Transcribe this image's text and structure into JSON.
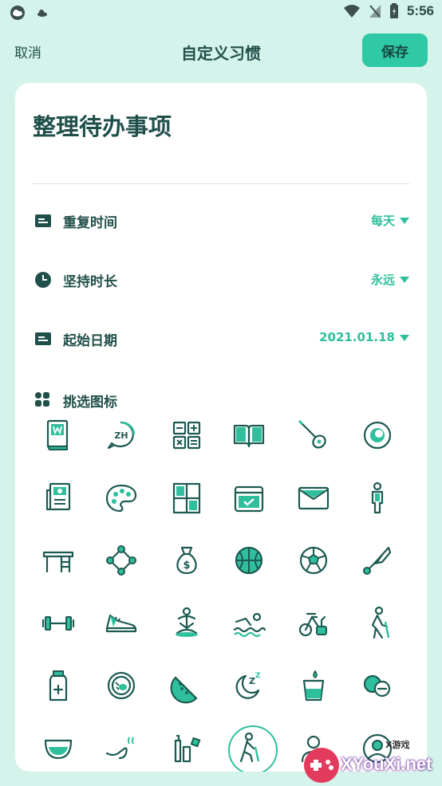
{
  "status_bar": {
    "time": "5:56"
  },
  "header": {
    "cancel_label": "取消",
    "title": "自定义习惯",
    "save_label": "保存"
  },
  "habit": {
    "name": "整理待办事项"
  },
  "settings": [
    {
      "label": "重复时间",
      "value": "每天",
      "icon": "card-icon"
    },
    {
      "label": "坚持时长",
      "value": "永远",
      "icon": "clock-icon"
    },
    {
      "label": "起始日期",
      "value": "2021.01.18",
      "icon": "card-icon"
    }
  ],
  "icon_picker": {
    "title": "挑选图标",
    "icons": [
      "word-book-icon",
      "zh-chat-icon",
      "calculator-icon",
      "open-book-icon",
      "guitar-icon",
      "eye-icon",
      "resume-icon",
      "palette-icon",
      "window-icon",
      "calendar-check-icon",
      "envelope-icon",
      "person-icon",
      "desk-icon",
      "network-icon",
      "money-bag-icon",
      "basketball-icon",
      "soccer-ball-icon",
      "badminton-icon",
      "dumbbell-icon",
      "sneaker-icon",
      "yoga-icon",
      "swimming-icon",
      "exercise-bike-icon",
      "hiking-icon",
      "medicine-bottle-icon",
      "egg-pan-icon",
      "watermelon-icon",
      "sleep-icon",
      "water-glass-icon",
      "pill-minus-icon",
      "bowl-icon",
      "pipe-icon",
      "bottles-icon",
      "walking-cane-icon",
      "user-icon",
      "avatar-circle-icon"
    ],
    "selected_index": 33
  },
  "colors": {
    "accent": "#2fbf9d",
    "icon_dark": "#1c5a52",
    "background": "#d4f3ea"
  },
  "watermark": {
    "text": "XYouXi.net",
    "small": "X游戏"
  }
}
